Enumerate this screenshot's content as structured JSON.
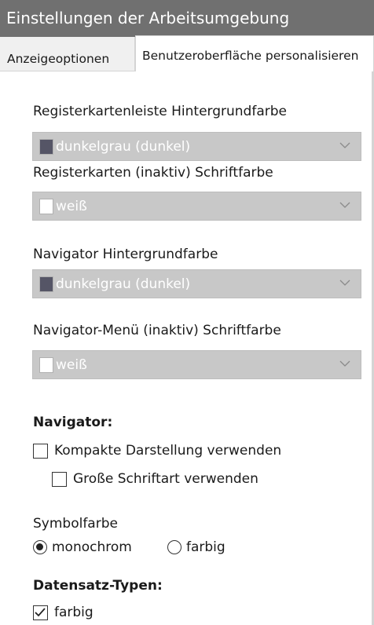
{
  "window": {
    "title": "Einstellungen der Arbeitsumgebung"
  },
  "tabs": [
    {
      "label": "Anzeigeoptionen",
      "active": false
    },
    {
      "label": "Benutzeroberfläche personalisieren",
      "active": true
    }
  ],
  "settings": [
    {
      "label": "Registerkartenleiste Hintergrundfarbe",
      "value": "dunkelgrau (dunkel)",
      "swatch_color": "#555566"
    },
    {
      "label": "Registerkarten (inaktiv) Schriftfarbe",
      "value": "weiß",
      "swatch_color": "#ffffff"
    },
    {
      "label": "Navigator Hintergrundfarbe",
      "value": "dunkelgrau (dunkel)",
      "swatch_color": "#555566"
    },
    {
      "label": "Navigator-Menü (inaktiv) Schriftfarbe",
      "value": "weiß",
      "swatch_color": "#ffffff"
    }
  ],
  "navigator": {
    "heading": "Navigator:",
    "compact_label": "Kompakte Darstellung verwenden",
    "compact_checked": false,
    "large_font_label": "Große Schriftart verwenden",
    "large_font_checked": false
  },
  "symbol_color": {
    "label": "Symbolfarbe",
    "options": [
      {
        "label": "monochrom",
        "selected": true
      },
      {
        "label": "farbig",
        "selected": false
      }
    ]
  },
  "record_types": {
    "heading": "Datensatz-Typen:",
    "colored_label": "farbig",
    "colored_checked": true
  }
}
